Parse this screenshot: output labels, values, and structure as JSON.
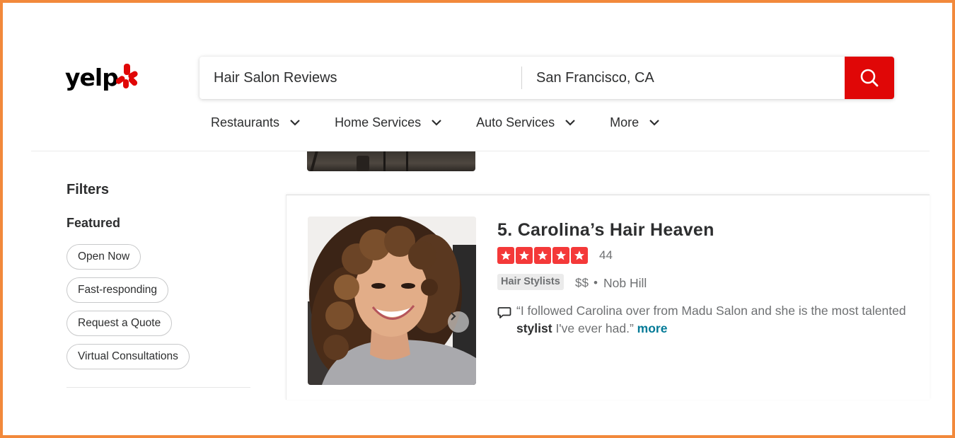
{
  "header": {
    "logo_text": "yelp",
    "search": {
      "find_value": "Hair Salon Reviews",
      "near_value": "San Francisco, CA"
    },
    "nav": [
      {
        "label": "Restaurants"
      },
      {
        "label": "Home Services"
      },
      {
        "label": "Auto Services"
      },
      {
        "label": "More"
      }
    ]
  },
  "sidebar": {
    "title": "Filters",
    "featured_title": "Featured",
    "chips": [
      "Open Now",
      "Fast-responding",
      "Request a Quote",
      "Virtual Consultations"
    ]
  },
  "result": {
    "name": "5. Carolina’s Hair Heaven",
    "rating": 5,
    "review_count": "44",
    "category": "Hair Stylists",
    "price": "$$",
    "separator": "•",
    "neighborhood": "Nob Hill",
    "snippet_before": "“I followed Carolina over from Madu Salon and she is the most talented ",
    "snippet_bold": "stylist",
    "snippet_after": " I've ever had.” ",
    "snippet_more": "more"
  },
  "colors": {
    "brand_red": "#e00707",
    "star_red": "#f43939",
    "frame_orange": "#f2893b",
    "link_teal": "#027a97"
  }
}
